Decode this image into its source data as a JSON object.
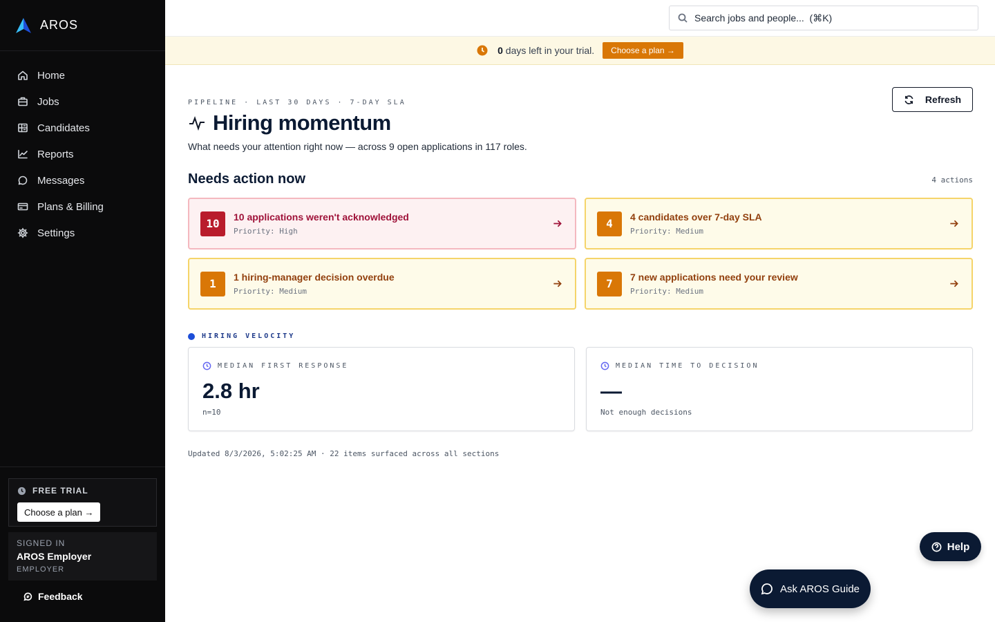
{
  "brand": {
    "name": "AROS"
  },
  "sidebar": {
    "items": [
      {
        "label": "Home",
        "icon": "home-icon"
      },
      {
        "label": "Jobs",
        "icon": "briefcase-icon"
      },
      {
        "label": "Candidates",
        "icon": "candidates-icon"
      },
      {
        "label": "Reports",
        "icon": "chart-icon"
      },
      {
        "label": "Messages",
        "icon": "message-icon"
      },
      {
        "label": "Plans & Billing",
        "icon": "credit-card-icon"
      },
      {
        "label": "Settings",
        "icon": "gear-icon"
      }
    ],
    "trial": {
      "label": "FREE TRIAL",
      "button": "Choose a plan →"
    },
    "signed_in": {
      "caption": "SIGNED IN",
      "name": "AROS Employer",
      "role": "EMPLOYER"
    },
    "feedback": "Feedback"
  },
  "search": {
    "placeholder": "Search jobs and people...  (⌘K)"
  },
  "banner": {
    "days": "0",
    "text": " days left in your trial.",
    "button": "Choose a plan →"
  },
  "header": {
    "eyebrow": "PIPELINE · LAST 30 DAYS · 7-DAY SLA",
    "title": "Hiring momentum",
    "subtitle": "What needs your attention right now — across 9 open applications in 117 roles.",
    "refresh": "Refresh"
  },
  "needs_action": {
    "title": "Needs action now",
    "count": "4 actions",
    "cards": [
      {
        "badge": "10",
        "title": "10 applications weren't acknowledged",
        "priority": "Priority: High",
        "level": "high"
      },
      {
        "badge": "4",
        "title": "4 candidates over 7-day SLA",
        "priority": "Priority: Medium",
        "level": "medium"
      },
      {
        "badge": "1",
        "title": "1 hiring-manager decision overdue",
        "priority": "Priority: Medium",
        "level": "medium"
      },
      {
        "badge": "7",
        "title": "7 new applications need your review",
        "priority": "Priority: Medium",
        "level": "medium"
      }
    ]
  },
  "velocity": {
    "title": "HIRING VELOCITY",
    "metrics": [
      {
        "label": "MEDIAN FIRST RESPONSE",
        "value": "2.8 hr",
        "note": "n=10"
      },
      {
        "label": "MEDIAN TIME TO DECISION",
        "value": "—",
        "note": "Not enough decisions"
      }
    ]
  },
  "updated": "Updated 8/3/2026, 5:02:25 AM · 22 items surfaced across all sections",
  "help": "Help",
  "guide": "Ask AROS Guide",
  "colors": {
    "accent": "#d97706",
    "high": "#b91c2c",
    "navy": "#0b1a33",
    "sidebar": "#0b0b0c"
  }
}
